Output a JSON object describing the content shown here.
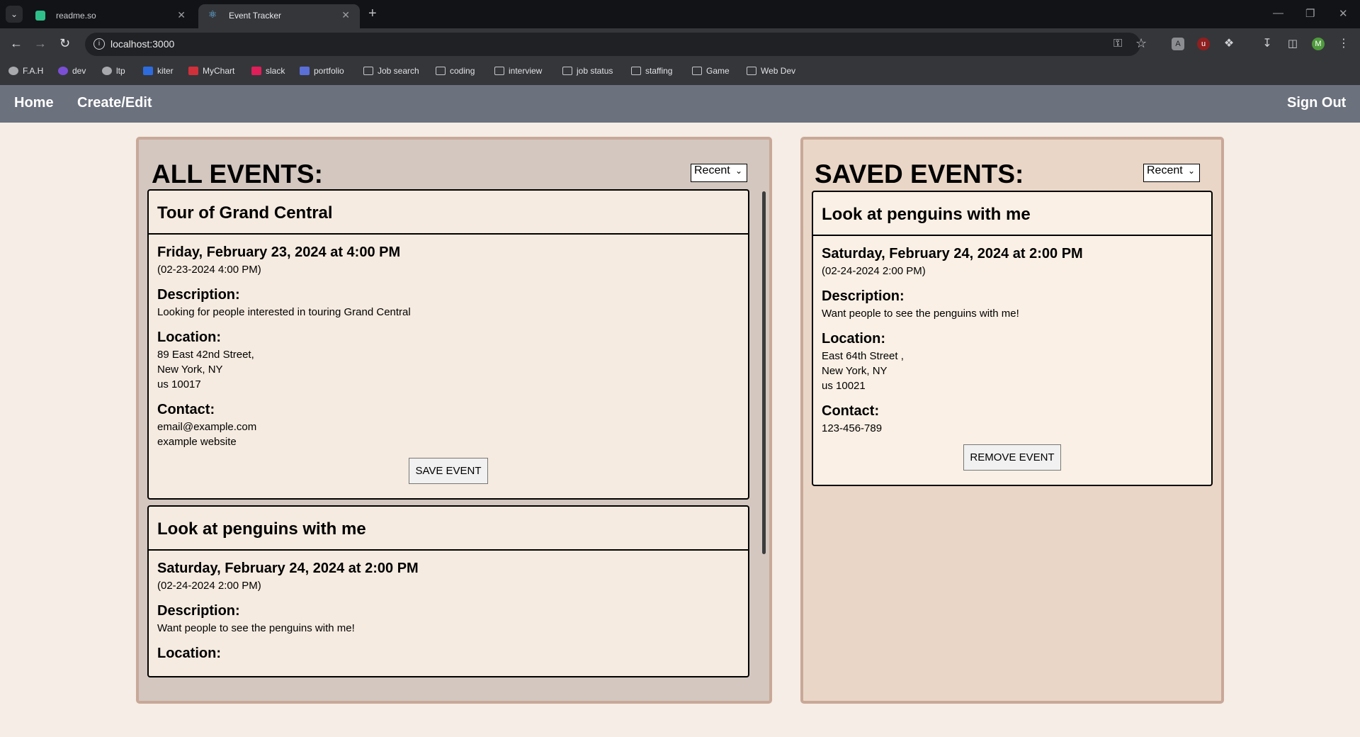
{
  "browser": {
    "tabs": [
      {
        "title": "readme.so",
        "active": false
      },
      {
        "title": "Event Tracker",
        "active": true
      }
    ],
    "url": "localhost:3000",
    "profile_initial": "M",
    "bookmarks": [
      {
        "label": "F.A.H",
        "icon": "globe-icon"
      },
      {
        "label": "dev",
        "icon": "dev-icon"
      },
      {
        "label": "ltp",
        "icon": "globe-icon"
      },
      {
        "label": "kiter",
        "icon": "kiter-icon"
      },
      {
        "label": "MyChart",
        "icon": "mychart-icon"
      },
      {
        "label": "slack",
        "icon": "slack-icon"
      },
      {
        "label": "portfolio",
        "icon": "portfolio-icon"
      },
      {
        "label": "Job search",
        "icon": "folder-icon"
      },
      {
        "label": "coding",
        "icon": "folder-icon"
      },
      {
        "label": "interview",
        "icon": "folder-icon"
      },
      {
        "label": "job status",
        "icon": "folder-icon"
      },
      {
        "label": "staffing",
        "icon": "folder-icon"
      },
      {
        "label": "Game",
        "icon": "folder-icon"
      },
      {
        "label": "Web Dev",
        "icon": "folder-icon"
      }
    ]
  },
  "nav": {
    "home": "Home",
    "create_edit": "Create/Edit",
    "sign_out": "Sign Out"
  },
  "all_events": {
    "heading": "ALL EVENTS:",
    "sort": "Recent",
    "events": [
      {
        "title": "Tour of Grand Central",
        "date_long": "Friday, February 23, 2024 at 4:00 PM",
        "date_short": "(02-23-2024 4:00 PM)",
        "description_label": "Description:",
        "description": "Looking for people interested in touring Grand Central",
        "location_label": "Location:",
        "location_line1": "89 East 42nd Street,",
        "location_line2": "New York, NY",
        "location_line3": "us 10017",
        "contact_label": "Contact:",
        "contact_line1": "email@example.com",
        "contact_line2": "example website",
        "button": "SAVE EVENT"
      },
      {
        "title": "Look at penguins with me",
        "date_long": "Saturday, February 24, 2024 at 2:00 PM",
        "date_short": "(02-24-2024 2:00 PM)",
        "description_label": "Description:",
        "description": "Want people to see the penguins with me!",
        "location_label": "Location:"
      }
    ]
  },
  "saved_events": {
    "heading": "SAVED EVENTS:",
    "sort": "Recent",
    "events": [
      {
        "title": "Look at penguins with me",
        "date_long": "Saturday, February 24, 2024 at 2:00 PM",
        "date_short": "(02-24-2024 2:00 PM)",
        "description_label": "Description:",
        "description": "Want people to see the penguins with me!",
        "location_label": "Location:",
        "location_line1": "East 64th Street ,",
        "location_line2": "New York, NY",
        "location_line3": "us 10021",
        "contact_label": "Contact:",
        "contact_line1": "123-456-789",
        "button": "REMOVE EVENT"
      }
    ]
  }
}
